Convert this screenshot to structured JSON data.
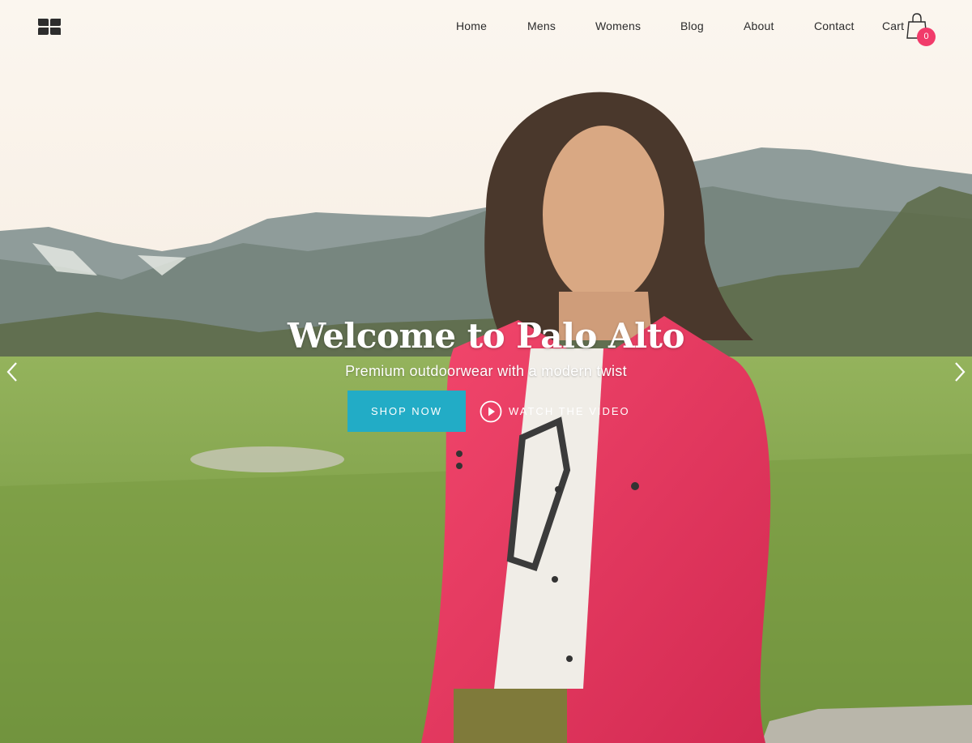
{
  "nav": {
    "items": [
      {
        "label": "Home"
      },
      {
        "label": "Mens"
      },
      {
        "label": "Womens"
      },
      {
        "label": "Blog"
      },
      {
        "label": "About"
      },
      {
        "label": "Contact"
      },
      {
        "label": "Cart"
      }
    ],
    "cart_count": "0"
  },
  "hero": {
    "title": "Welcome to Palo Alto",
    "subtitle": "Premium outdoorwear with a modern twist",
    "primary_button": "SHOP NOW",
    "secondary_link": "WATCH THE VIDEO"
  },
  "icons": {
    "logo": "four-petal-logo-icon",
    "cart": "shopping-bag-icon",
    "play": "play-circle-icon",
    "prev": "chevron-left-icon",
    "next": "chevron-right-icon"
  },
  "colors": {
    "accent_button": "#22acc6",
    "cart_badge": "#f13b6a",
    "nav_text": "#2b2b2b"
  }
}
